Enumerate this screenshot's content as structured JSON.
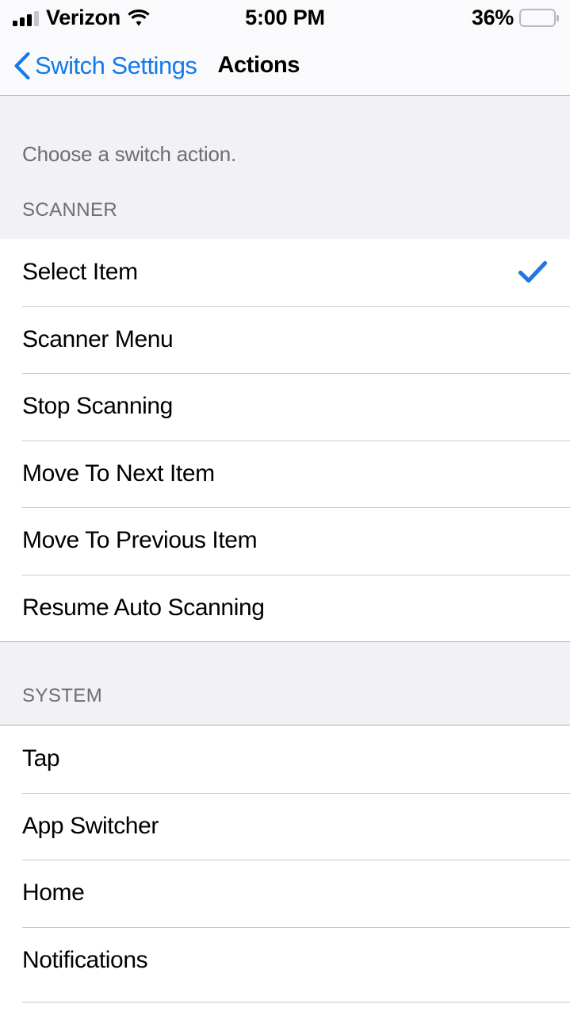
{
  "status_bar": {
    "carrier": "Verizon",
    "time": "5:00 PM",
    "battery_percent": "36%",
    "signal_icon": "cellular-signal-icon",
    "wifi_icon": "wifi-icon",
    "battery_icon": "battery-icon",
    "signal_bars_filled": 3,
    "signal_bars_total": 4,
    "battery_level": 36
  },
  "nav_bar": {
    "back_label": "Switch Settings",
    "back_icon": "chevron-left-icon",
    "title": "Actions"
  },
  "content": {
    "description": "Choose a switch action.",
    "sections": [
      {
        "title": "SCANNER",
        "rows": [
          {
            "label": "Select Item",
            "checked": true
          },
          {
            "label": "Scanner Menu",
            "checked": false
          },
          {
            "label": "Stop Scanning",
            "checked": false
          },
          {
            "label": "Move To Next Item",
            "checked": false
          },
          {
            "label": "Move To Previous Item",
            "checked": false
          },
          {
            "label": "Resume Auto Scanning",
            "checked": false
          }
        ]
      },
      {
        "title": "SYSTEM",
        "rows": [
          {
            "label": "Tap",
            "checked": false
          },
          {
            "label": "App Switcher",
            "checked": false
          },
          {
            "label": "Home",
            "checked": false
          },
          {
            "label": "Notifications",
            "checked": false
          }
        ]
      }
    ]
  },
  "colors": {
    "accent_blue": "#137aec",
    "checkmark_blue": "#2079dd",
    "group_background": "#f1f1f6",
    "separator": "#c8c7cc",
    "secondary_text": "#6d6d72"
  }
}
